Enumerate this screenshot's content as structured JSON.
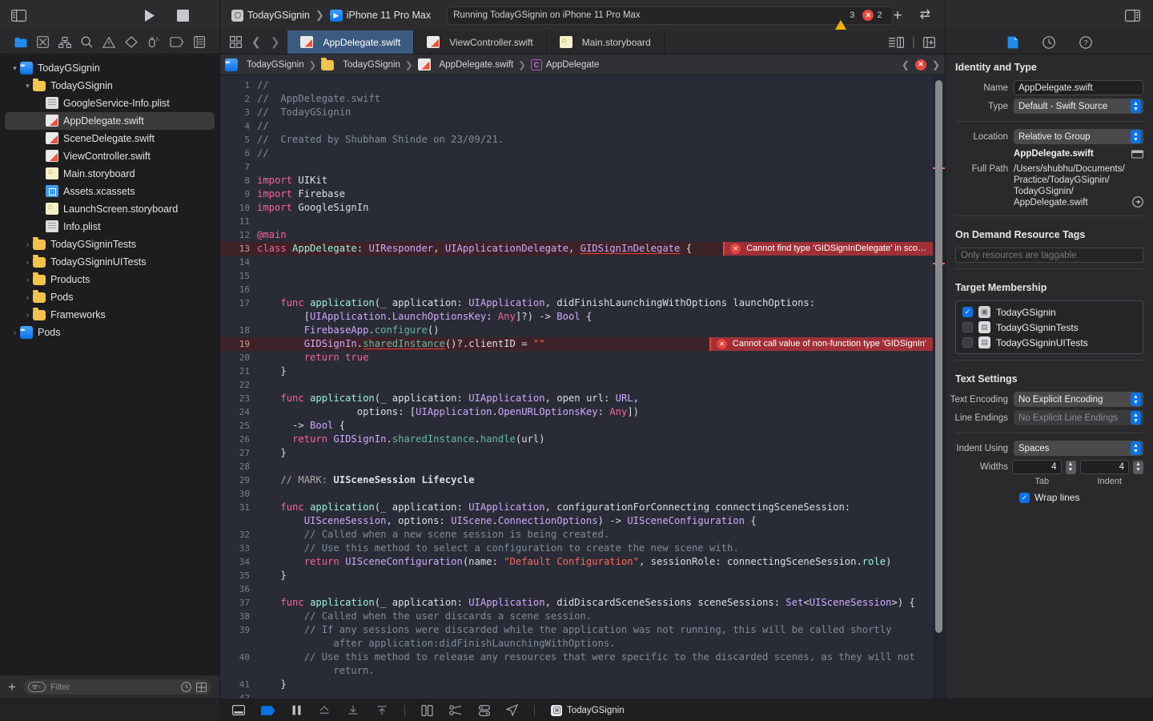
{
  "toolbar": {
    "scheme_name": "TodayGSignin",
    "destination": "iPhone 11 Pro Max",
    "status_text": "Running TodayGSignin on iPhone 11 Pro Max",
    "warning_count": "3",
    "error_count": "2",
    "warning_glyph": "!",
    "error_glyph": "✕",
    "add_label": "+",
    "swap_label": "⇄"
  },
  "navigator": {
    "filter_placeholder": "Filter",
    "items": [
      {
        "label": "TodayGSignin",
        "icon": "project-icon",
        "indent": 0,
        "disc": "▾",
        "kind": "proj",
        "selected": false
      },
      {
        "label": "TodayGSignin",
        "icon": "folder-icon",
        "indent": 1,
        "disc": "▾",
        "kind": "folder",
        "selected": false
      },
      {
        "label": "GoogleService-Info.plist",
        "icon": "plist-icon",
        "indent": 2,
        "disc": "",
        "kind": "plist",
        "selected": false
      },
      {
        "label": "AppDelegate.swift",
        "icon": "swift-file-icon",
        "indent": 2,
        "disc": "",
        "kind": "swift",
        "selected": true
      },
      {
        "label": "SceneDelegate.swift",
        "icon": "swift-file-icon",
        "indent": 2,
        "disc": "",
        "kind": "swift",
        "selected": false
      },
      {
        "label": "ViewController.swift",
        "icon": "swift-file-icon",
        "indent": 2,
        "disc": "",
        "kind": "swift",
        "selected": false
      },
      {
        "label": "Main.storyboard",
        "icon": "storyboard-icon",
        "indent": 2,
        "disc": "",
        "kind": "story",
        "selected": false
      },
      {
        "label": "Assets.xcassets",
        "icon": "assets-icon",
        "indent": 2,
        "disc": "",
        "kind": "assets",
        "selected": false
      },
      {
        "label": "LaunchScreen.storyboard",
        "icon": "storyboard-icon",
        "indent": 2,
        "disc": "",
        "kind": "story",
        "selected": false
      },
      {
        "label": "Info.plist",
        "icon": "plist-icon",
        "indent": 2,
        "disc": "",
        "kind": "plist",
        "selected": false
      },
      {
        "label": "TodayGSigninTests",
        "icon": "folder-icon",
        "indent": 1,
        "disc": "›",
        "kind": "folder",
        "selected": false
      },
      {
        "label": "TodayGSigninUITests",
        "icon": "folder-icon",
        "indent": 1,
        "disc": "›",
        "kind": "folder",
        "selected": false
      },
      {
        "label": "Products",
        "icon": "folder-icon",
        "indent": 1,
        "disc": "›",
        "kind": "folder",
        "selected": false
      },
      {
        "label": "Pods",
        "icon": "folder-icon",
        "indent": 1,
        "disc": "›",
        "kind": "folder",
        "selected": false
      },
      {
        "label": "Frameworks",
        "icon": "folder-icon",
        "indent": 1,
        "disc": "›",
        "kind": "folder",
        "selected": false
      },
      {
        "label": "Pods",
        "icon": "project-icon",
        "indent": 0,
        "disc": "›",
        "kind": "proj",
        "selected": false
      }
    ]
  },
  "editor": {
    "tabs": [
      {
        "label": "AppDelegate.swift",
        "kind": "swift",
        "active": true
      },
      {
        "label": "ViewController.swift",
        "kind": "swift",
        "active": false
      },
      {
        "label": "Main.storyboard",
        "kind": "story",
        "active": false
      }
    ],
    "breadcrumb": [
      {
        "label": "TodayGSignin",
        "kind": "proj"
      },
      {
        "label": "TodayGSignin",
        "kind": "folder"
      },
      {
        "label": "AppDelegate.swift",
        "kind": "swift"
      },
      {
        "label": "AppDelegate",
        "kind": "class"
      }
    ],
    "breadcrumb_error_glyph": "✕",
    "errors": [
      {
        "line": 13,
        "message": "Cannot find type 'GIDSignInDelegate' in sco…"
      },
      {
        "line": 19,
        "message": "Cannot call value of non-function type 'GIDSignIn'"
      }
    ],
    "code_lines": [
      {
        "n": "1",
        "tokens": [
          [
            "cm",
            "//"
          ]
        ]
      },
      {
        "n": "2",
        "tokens": [
          [
            "cm",
            "//  AppDelegate.swift"
          ]
        ]
      },
      {
        "n": "3",
        "tokens": [
          [
            "cm",
            "//  TodayGSignin"
          ]
        ]
      },
      {
        "n": "4",
        "tokens": [
          [
            "cm",
            "//"
          ]
        ]
      },
      {
        "n": "5",
        "tokens": [
          [
            "cm",
            "//  Created by Shubham Shinde on 23/09/21."
          ]
        ]
      },
      {
        "n": "6",
        "tokens": [
          [
            "cm",
            "//"
          ]
        ]
      },
      {
        "n": "7",
        "tokens": []
      },
      {
        "n": "8",
        "tokens": [
          [
            "kw",
            "import"
          ],
          [
            "pl",
            " UIKit"
          ]
        ]
      },
      {
        "n": "9",
        "tokens": [
          [
            "kw",
            "import"
          ],
          [
            "pl",
            " Firebase"
          ]
        ]
      },
      {
        "n": "10",
        "tokens": [
          [
            "kw",
            "import"
          ],
          [
            "pl",
            " GoogleSignIn"
          ]
        ]
      },
      {
        "n": "11",
        "tokens": []
      },
      {
        "n": "12",
        "tokens": [
          [
            "kw",
            "@main"
          ]
        ]
      },
      {
        "n": "13",
        "err": true,
        "tokens": [
          [
            "kw",
            "class"
          ],
          [
            "pl",
            " "
          ],
          [
            "ob",
            "AppDelegate"
          ],
          [
            "pl",
            ": "
          ],
          [
            "ty",
            "UIResponder"
          ],
          [
            "pl",
            ", "
          ],
          [
            "ty",
            "UIApplicationDelegate"
          ],
          [
            "pl",
            ", "
          ],
          [
            "tyu",
            "GIDSignInDelegate"
          ],
          [
            "pl",
            " {"
          ]
        ]
      },
      {
        "n": "14",
        "tokens": []
      },
      {
        "n": "15",
        "tokens": []
      },
      {
        "n": "16",
        "tokens": []
      },
      {
        "n": "17",
        "tokens": [
          [
            "pl",
            "    "
          ],
          [
            "kw",
            "func"
          ],
          [
            "pl",
            " "
          ],
          [
            "ob",
            "application"
          ],
          [
            "pl",
            "(_ application: "
          ],
          [
            "ty",
            "UIApplication"
          ],
          [
            "pl",
            ", didFinishLaunchingWithOptions launchOptions:"
          ]
        ]
      },
      {
        "n": "",
        "tokens": [
          [
            "pl",
            "        ["
          ],
          [
            "ty",
            "UIApplication"
          ],
          [
            "pl",
            "."
          ],
          [
            "ty",
            "LaunchOptionsKey"
          ],
          [
            "pl",
            ": "
          ],
          [
            "kw",
            "Any"
          ],
          [
            "pl",
            "]?) -> "
          ],
          [
            "ty",
            "Bool"
          ],
          [
            "pl",
            " {"
          ]
        ]
      },
      {
        "n": "18",
        "tokens": [
          [
            "pl",
            "        "
          ],
          [
            "ty",
            "FirebaseApp"
          ],
          [
            "pl",
            "."
          ],
          [
            "fn",
            "configure"
          ],
          [
            "pl",
            "()"
          ]
        ]
      },
      {
        "n": "19",
        "err": true,
        "tokens": [
          [
            "pl",
            "        "
          ],
          [
            "ty",
            "GIDSignIn"
          ],
          [
            "pl",
            "."
          ],
          [
            "fnu",
            "sharedInstance"
          ],
          [
            "pl",
            "()?.clientID = "
          ],
          [
            "st",
            "\"\""
          ]
        ]
      },
      {
        "n": "20",
        "tokens": [
          [
            "pl",
            "        "
          ],
          [
            "kw",
            "return"
          ],
          [
            "pl",
            " "
          ],
          [
            "kw",
            "true"
          ]
        ]
      },
      {
        "n": "21",
        "tokens": [
          [
            "pl",
            "    }"
          ]
        ]
      },
      {
        "n": "22",
        "tokens": []
      },
      {
        "n": "23",
        "tokens": [
          [
            "pl",
            "    "
          ],
          [
            "kw",
            "func"
          ],
          [
            "pl",
            " "
          ],
          [
            "ob",
            "application"
          ],
          [
            "pl",
            "(_ application: "
          ],
          [
            "ty",
            "UIApplication"
          ],
          [
            "pl",
            ", open url: "
          ],
          [
            "ty",
            "URL"
          ],
          [
            "pl",
            ","
          ]
        ]
      },
      {
        "n": "24",
        "tokens": [
          [
            "pl",
            "                 options: ["
          ],
          [
            "ty",
            "UIApplication"
          ],
          [
            "pl",
            "."
          ],
          [
            "ty",
            "OpenURLOptionsKey"
          ],
          [
            "pl",
            ": "
          ],
          [
            "kw",
            "Any"
          ],
          [
            "pl",
            "])"
          ]
        ]
      },
      {
        "n": "25",
        "tokens": [
          [
            "pl",
            "      -> "
          ],
          [
            "ty",
            "Bool"
          ],
          [
            "pl",
            " {"
          ]
        ]
      },
      {
        "n": "26",
        "tokens": [
          [
            "pl",
            "      "
          ],
          [
            "kw",
            "return"
          ],
          [
            "pl",
            " "
          ],
          [
            "ty",
            "GIDSignIn"
          ],
          [
            "pl",
            "."
          ],
          [
            "fn",
            "sharedInstance"
          ],
          [
            "pl",
            "."
          ],
          [
            "fn",
            "handle"
          ],
          [
            "pl",
            "(url)"
          ]
        ]
      },
      {
        "n": "27",
        "tokens": [
          [
            "pl",
            "    }"
          ]
        ]
      },
      {
        "n": "28",
        "tokens": []
      },
      {
        "n": "29",
        "tokens": [
          [
            "mk",
            "    // MARK: "
          ],
          [
            "mkb",
            "UISceneSession Lifecycle"
          ]
        ]
      },
      {
        "n": "30",
        "tokens": []
      },
      {
        "n": "31",
        "tokens": [
          [
            "pl",
            "    "
          ],
          [
            "kw",
            "func"
          ],
          [
            "pl",
            " "
          ],
          [
            "ob",
            "application"
          ],
          [
            "pl",
            "(_ application: "
          ],
          [
            "ty",
            "UIApplication"
          ],
          [
            "pl",
            ", configurationForConnecting connectingSceneSession:"
          ]
        ]
      },
      {
        "n": "",
        "tokens": [
          [
            "pl",
            "        "
          ],
          [
            "ty",
            "UISceneSession"
          ],
          [
            "pl",
            ", options: "
          ],
          [
            "ty",
            "UIScene"
          ],
          [
            "pl",
            "."
          ],
          [
            "ty",
            "ConnectionOptions"
          ],
          [
            "pl",
            ") -> "
          ],
          [
            "ty",
            "UISceneConfiguration"
          ],
          [
            "pl",
            " {"
          ]
        ]
      },
      {
        "n": "32",
        "tokens": [
          [
            "cm",
            "        // Called when a new scene session is being created."
          ]
        ]
      },
      {
        "n": "33",
        "tokens": [
          [
            "cm",
            "        // Use this method to select a configuration to create the new scene with."
          ]
        ]
      },
      {
        "n": "34",
        "tokens": [
          [
            "pl",
            "        "
          ],
          [
            "kw",
            "return"
          ],
          [
            "pl",
            " "
          ],
          [
            "ty",
            "UISceneConfiguration"
          ],
          [
            "pl",
            "(name: "
          ],
          [
            "st",
            "\"Default Configuration\""
          ],
          [
            "pl",
            ", sessionRole: connectingSceneSession."
          ],
          [
            "ob",
            "role"
          ],
          [
            "pl",
            ")"
          ]
        ]
      },
      {
        "n": "35",
        "tokens": [
          [
            "pl",
            "    }"
          ]
        ]
      },
      {
        "n": "36",
        "tokens": []
      },
      {
        "n": "37",
        "tokens": [
          [
            "pl",
            "    "
          ],
          [
            "kw",
            "func"
          ],
          [
            "pl",
            " "
          ],
          [
            "ob",
            "application"
          ],
          [
            "pl",
            "(_ application: "
          ],
          [
            "ty",
            "UIApplication"
          ],
          [
            "pl",
            ", didDiscardSceneSessions sceneSessions: "
          ],
          [
            "ty",
            "Set"
          ],
          [
            "pl",
            "<"
          ],
          [
            "ty",
            "UISceneSession"
          ],
          [
            "pl",
            ">) {"
          ]
        ]
      },
      {
        "n": "38",
        "tokens": [
          [
            "cm",
            "        // Called when the user discards a scene session."
          ]
        ]
      },
      {
        "n": "39",
        "tokens": [
          [
            "cm",
            "        // If any sessions were discarded while the application was not running, this will be called shortly"
          ]
        ]
      },
      {
        "n": "",
        "tokens": [
          [
            "cm",
            "             after application:didFinishLaunchingWithOptions."
          ]
        ]
      },
      {
        "n": "40",
        "tokens": [
          [
            "cm",
            "        // Use this method to release any resources that were specific to the discarded scenes, as they will not"
          ]
        ]
      },
      {
        "n": "",
        "tokens": [
          [
            "cm",
            "             return."
          ]
        ]
      },
      {
        "n": "41",
        "tokens": [
          [
            "pl",
            "    }"
          ]
        ]
      },
      {
        "n": "42",
        "tokens": []
      }
    ]
  },
  "inspector": {
    "sections": {
      "identity_title": "Identity and Type",
      "ondemand_title": "On Demand Resource Tags",
      "target_title": "Target Membership",
      "text_title": "Text Settings"
    },
    "labels": {
      "name": "Name",
      "type": "Type",
      "location": "Location",
      "full_path": "Full Path",
      "text_encoding": "Text Encoding",
      "line_endings": "Line Endings",
      "indent_using": "Indent Using",
      "widths": "Widths",
      "tab": "Tab",
      "indent": "Indent",
      "wrap_lines": "Wrap lines"
    },
    "values": {
      "name": "AppDelegate.swift",
      "type": "Default - Swift Source",
      "location": "Relative to Group",
      "location_file": "AppDelegate.swift",
      "full_path_lines": [
        "/Users/shubhu/Documents/",
        "Practice/TodayGSignin/",
        "TodayGSignin/",
        "AppDelegate.swift"
      ],
      "ondemand_placeholder": "Only resources are taggable",
      "text_encoding": "No Explicit Encoding",
      "line_endings": "No Explicit Line Endings",
      "indent_using": "Spaces",
      "tab_width": "4",
      "indent_width": "4",
      "wrap_lines_checked": true
    },
    "targets": [
      {
        "label": "TodayGSignin",
        "checked": true,
        "icon": "app-target-icon"
      },
      {
        "label": "TodayGSigninTests",
        "checked": false,
        "icon": "test-target-icon"
      },
      {
        "label": "TodayGSigninUITests",
        "checked": false,
        "icon": "test-target-icon"
      }
    ]
  },
  "bottom": {
    "process_name": "TodayGSignin"
  },
  "colors": {
    "accent": "#0a72e8",
    "error": "#e8453c",
    "warning": "#f0b400",
    "tab_active": "#3b5a7f",
    "editor_bg": "#292c36"
  }
}
